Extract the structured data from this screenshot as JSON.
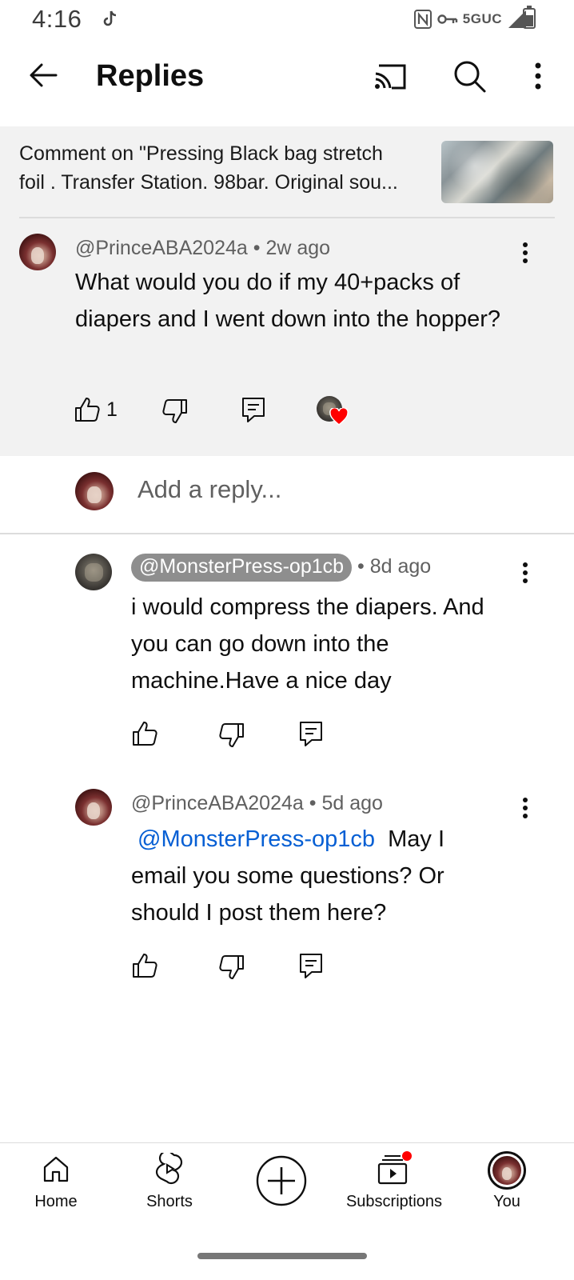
{
  "status_bar": {
    "time": "4:16",
    "network": "5GUC"
  },
  "header": {
    "title": "Replies",
    "icons": [
      "back-arrow-icon",
      "cast-icon",
      "search-icon",
      "more-vert-icon"
    ]
  },
  "video_context": {
    "line1": "Comment on \"Pressing Black bag stretch",
    "line2": "foil . Transfer Station. 98bar. Original sou..."
  },
  "parent_comment": {
    "author": "@PrinceABA2024a",
    "separator": "•",
    "time": "2w ago",
    "text": "What would you do if my 40+packs of diapers and I went down into the hopper?",
    "likes": "1"
  },
  "reply_box": {
    "placeholder": "Add a reply..."
  },
  "replies": [
    {
      "author": "@MonsterPress-op1cb",
      "separator": "•",
      "time": "8d ago",
      "text": "i would compress the diapers. And you can go down into the machine.Have a nice day"
    },
    {
      "author": "@PrinceABA2024a",
      "separator": "•",
      "time": "5d ago",
      "mention": "@MonsterPress-op1cb",
      "text": "May I email you some questions? Or should I post them here?"
    }
  ],
  "bottom_nav": {
    "home": "Home",
    "shorts": "Shorts",
    "subscriptions": "Subscriptions",
    "you": "You"
  },
  "colors": {
    "link": "#065fd4",
    "heart": "#ff0000",
    "chip": "#8e8e8e",
    "parent_bg": "#f2f2f2"
  }
}
